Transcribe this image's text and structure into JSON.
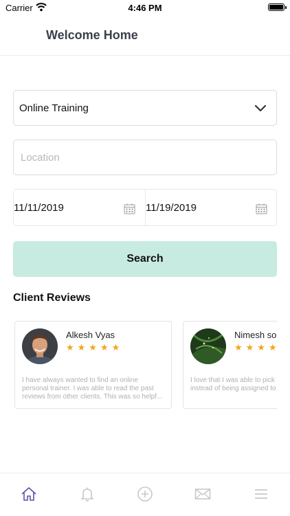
{
  "status_bar": {
    "carrier": "Carrier",
    "time": "4:46 PM"
  },
  "header": {
    "title": "Welcome Home"
  },
  "form": {
    "category_value": "Online Training",
    "location_placeholder": "Location",
    "start_date": "11/11/2019",
    "end_date": "11/19/2019",
    "search_label": "Search"
  },
  "reviews": {
    "title": "Client Reviews",
    "items": [
      {
        "name": "Alkesh Vyas",
        "stars": "★★★★★",
        "text": "I have always wanted to find an online\npersonal trainer. I was able to read the past\nreviews from other clients. This was so helpf..."
      },
      {
        "name": "Nimesh sor",
        "stars": "★★★★",
        "text": "I love that I was able to pick a\ninstead of being assigned to"
      }
    ]
  },
  "tab_bar": {
    "items": [
      "home-icon",
      "bell-icon",
      "add-icon",
      "mail-icon",
      "menu-icon"
    ],
    "active": "home-icon",
    "active_color": "#5a52a8",
    "inactive_color": "#c8c8c8"
  },
  "colors": {
    "accent_button": "#c7ebe0",
    "star": "#f2a51a"
  }
}
